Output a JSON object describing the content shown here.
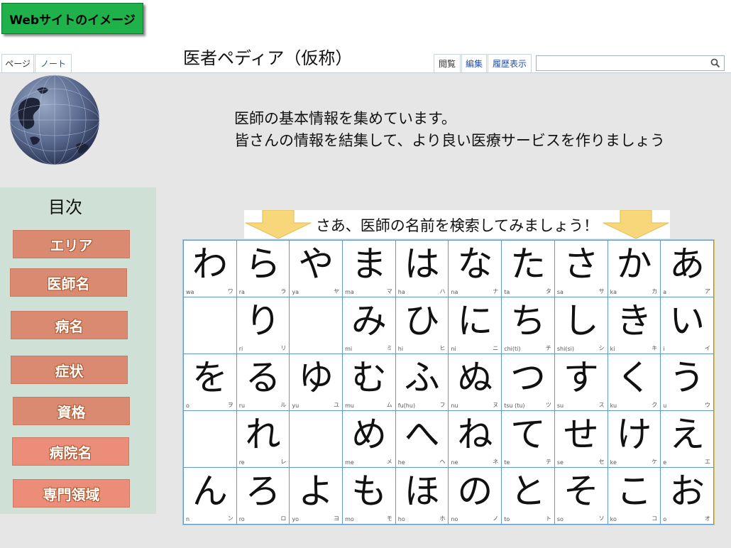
{
  "badge": {
    "label": "Webサイトのイメージ"
  },
  "tabs": {
    "left": [
      {
        "label": "ページ"
      },
      {
        "label": "ノート"
      }
    ],
    "right": [
      {
        "label": "閲覧"
      },
      {
        "label": "編集"
      },
      {
        "label": "履歴表示"
      }
    ]
  },
  "page_title": "医者ペディア（仮称）",
  "search": {
    "value": "",
    "placeholder": ""
  },
  "intro": {
    "line1": "医師の基本情報を集めています。",
    "line2": "皆さんの情報を結集して、より良い医療サービスを作りましょう"
  },
  "toc": {
    "title": "目次",
    "items": [
      {
        "label": "エリア"
      },
      {
        "label": "医師名"
      },
      {
        "label": "病名"
      },
      {
        "label": "症状"
      },
      {
        "label": "資格"
      },
      {
        "label": "病院名"
      },
      {
        "label": "専門領域"
      }
    ]
  },
  "banner": {
    "text": "さあ、医師の名前を検索してみましょう！"
  },
  "colors": {
    "badge": "#1fb14a",
    "toc_bg": "#cfe0d6",
    "toc_button": "#d98a70",
    "grid_line": "#5f9ac9",
    "arrow": "#f7d77a"
  },
  "kana": [
    [
      {
        "k": "わ",
        "r": "wa",
        "t": "ワ"
      },
      {
        "k": "ら",
        "r": "ra",
        "t": "ラ"
      },
      {
        "k": "や",
        "r": "ya",
        "t": "ヤ"
      },
      {
        "k": "ま",
        "r": "ma",
        "t": "マ"
      },
      {
        "k": "は",
        "r": "ha",
        "t": "ハ"
      },
      {
        "k": "な",
        "r": "na",
        "t": "ナ"
      },
      {
        "k": "た",
        "r": "ta",
        "t": "タ"
      },
      {
        "k": "さ",
        "r": "sa",
        "t": "サ"
      },
      {
        "k": "か",
        "r": "ka",
        "t": "カ"
      },
      {
        "k": "あ",
        "r": "a",
        "t": "ア"
      }
    ],
    [
      {
        "k": "",
        "r": "",
        "t": ""
      },
      {
        "k": "り",
        "r": "ri",
        "t": "リ"
      },
      {
        "k": "",
        "r": "",
        "t": ""
      },
      {
        "k": "み",
        "r": "mi",
        "t": "ミ"
      },
      {
        "k": "ひ",
        "r": "hi",
        "t": "ヒ"
      },
      {
        "k": "に",
        "r": "ni",
        "t": "ニ"
      },
      {
        "k": "ち",
        "r": "chi(ti)",
        "t": "チ"
      },
      {
        "k": "し",
        "r": "shi(si)",
        "t": "シ"
      },
      {
        "k": "き",
        "r": "ki",
        "t": "キ"
      },
      {
        "k": "い",
        "r": "i",
        "t": "イ"
      }
    ],
    [
      {
        "k": "を",
        "r": "o",
        "t": "ヲ"
      },
      {
        "k": "る",
        "r": "ru",
        "t": "ル"
      },
      {
        "k": "ゆ",
        "r": "yu",
        "t": "ユ"
      },
      {
        "k": "む",
        "r": "mu",
        "t": "ム"
      },
      {
        "k": "ふ",
        "r": "fu(hu)",
        "t": "フ"
      },
      {
        "k": "ぬ",
        "r": "nu",
        "t": "ヌ"
      },
      {
        "k": "つ",
        "r": "tsu (tu)",
        "t": "ツ"
      },
      {
        "k": "す",
        "r": "su",
        "t": "ス"
      },
      {
        "k": "く",
        "r": "ku",
        "t": "ク"
      },
      {
        "k": "う",
        "r": "u",
        "t": "ウ"
      }
    ],
    [
      {
        "k": "",
        "r": "",
        "t": ""
      },
      {
        "k": "れ",
        "r": "re",
        "t": "レ"
      },
      {
        "k": "",
        "r": "",
        "t": ""
      },
      {
        "k": "め",
        "r": "me",
        "t": "メ"
      },
      {
        "k": "へ",
        "r": "he",
        "t": "ヘ"
      },
      {
        "k": "ね",
        "r": "ne",
        "t": "ネ"
      },
      {
        "k": "て",
        "r": "te",
        "t": "テ"
      },
      {
        "k": "せ",
        "r": "se",
        "t": "セ"
      },
      {
        "k": "け",
        "r": "ke",
        "t": "ケ"
      },
      {
        "k": "え",
        "r": "e",
        "t": "エ"
      }
    ],
    [
      {
        "k": "ん",
        "r": "n",
        "t": "ン"
      },
      {
        "k": "ろ",
        "r": "ro",
        "t": "ロ"
      },
      {
        "k": "よ",
        "r": "yo",
        "t": "ヨ"
      },
      {
        "k": "も",
        "r": "mo",
        "t": "モ"
      },
      {
        "k": "ほ",
        "r": "ho",
        "t": "ホ"
      },
      {
        "k": "の",
        "r": "no",
        "t": "ノ"
      },
      {
        "k": "と",
        "r": "to",
        "t": "ト"
      },
      {
        "k": "そ",
        "r": "so",
        "t": "ソ"
      },
      {
        "k": "こ",
        "r": "ko",
        "t": "コ"
      },
      {
        "k": "お",
        "r": "o",
        "t": "オ"
      }
    ]
  ]
}
